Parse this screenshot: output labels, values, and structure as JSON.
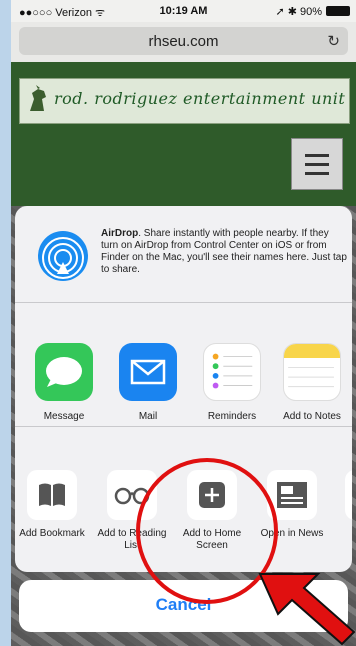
{
  "status_bar": {
    "carrier": "●●○○○ Verizon ᯤ",
    "time": "10:19 AM",
    "battery": "➚ ✱ 90%"
  },
  "browser": {
    "url": "rhseu.com",
    "reload_icon": "reload-icon"
  },
  "site": {
    "banner_text": "rod. rodriguez entertainment unit",
    "menu_icon": "hamburger-menu-icon"
  },
  "share_sheet": {
    "airdrop": {
      "title": "AirDrop",
      "description": ". Share instantly with people nearby. If they turn on AirDrop from Control Center on iOS or from Finder on the Mac, you'll see their names here. Just tap to share."
    },
    "apps": [
      {
        "label": "Message",
        "icon": "message-icon",
        "color": "#34c759"
      },
      {
        "label": "Mail",
        "icon": "mail-icon",
        "color": "#1a84f0"
      },
      {
        "label": "Reminders",
        "icon": "reminders-icon",
        "color": "#ffffff"
      },
      {
        "label": "Add to Notes",
        "icon": "notes-icon",
        "color": "#f8d54a"
      },
      {
        "label": "S",
        "icon": "partial-app-icon",
        "color": "#f4a12a"
      }
    ],
    "actions": [
      {
        "label": "Add Bookmark",
        "icon": "bookmark-icon"
      },
      {
        "label": "Add to Reading List",
        "icon": "reading-list-icon"
      },
      {
        "label": "Add to Home Screen",
        "icon": "add-home-screen-icon"
      },
      {
        "label": "Open in News",
        "icon": "news-icon"
      },
      {
        "label": "",
        "icon": "partial-action-icon"
      }
    ],
    "cancel_label": "Cancel"
  },
  "annotations": {
    "highlight_color": "#e01010"
  }
}
